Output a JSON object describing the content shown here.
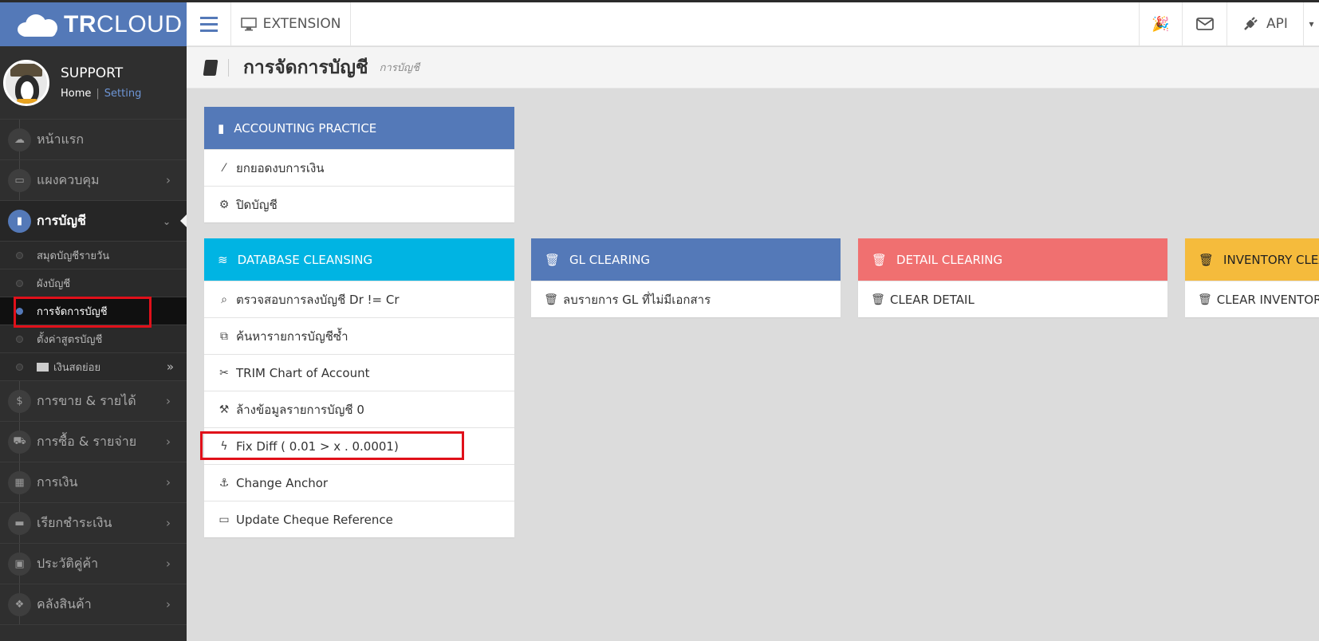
{
  "brand": {
    "name_bold": "TR",
    "name_light": "CLOUD",
    "color": "#5479b8"
  },
  "header": {
    "extension_label": "EXTENSION",
    "api_label": "API"
  },
  "profile": {
    "name": "SUPPORT",
    "home": "Home",
    "separator": "|",
    "setting": "Setting"
  },
  "sidebar": {
    "items": [
      {
        "label": "หน้าแรก",
        "icon": "cloud-icon"
      },
      {
        "label": "แผงควบคุม",
        "icon": "monitor-icon"
      },
      {
        "label": "การบัญชี",
        "icon": "book-icon"
      },
      {
        "label": "การขาย & รายได้",
        "icon": "dollar-icon"
      },
      {
        "label": "การซื้อ & รายจ่าย",
        "icon": "cart-icon"
      },
      {
        "label": "การเงิน",
        "icon": "calendar-icon"
      },
      {
        "label": "เรียกชำระเงิน",
        "icon": "credit-card-icon"
      },
      {
        "label": "ประวัติคู่ค้า",
        "icon": "contact-icon"
      },
      {
        "label": "คลังสินค้า",
        "icon": "cubes-icon"
      }
    ],
    "subitems": [
      {
        "label": "สมุดบัญชีรายวัน"
      },
      {
        "label": "ผังบัญชี"
      },
      {
        "label": "การจัดการบัญชี"
      },
      {
        "label": "ตั้งค่าสูตรบัญชี"
      },
      {
        "label": "เงินสดย่อย"
      }
    ]
  },
  "page": {
    "title": "การจัดการบัญชี",
    "subtitle": "การบัญชี"
  },
  "panels": {
    "accounting": {
      "title": "ACCOUNTING PRACTICE",
      "color": "#5479b8",
      "rows": [
        {
          "label": "ยกยอดงบการเงิน",
          "icon": "magic-wand-icon"
        },
        {
          "label": "ปิดบัญชี",
          "icon": "gear-icon"
        }
      ]
    },
    "cleansing": {
      "title": "DATABASE CLEANSING",
      "color": "#00b4e3",
      "rows": [
        {
          "label": "ตรวจสอบการลงบัญชี Dr != Cr",
          "icon": "search-icon"
        },
        {
          "label": "ค้นหารายการบัญชีซ้ำ",
          "icon": "copy-icon"
        },
        {
          "label": "TRIM Chart of Account",
          "icon": "scissors-icon"
        },
        {
          "label": "ล้างข้อมูลรายการบัญชี 0",
          "icon": "wrench-icon"
        },
        {
          "label": "Fix Diff ( 0.01 > x . 0.0001)",
          "icon": "bolt-icon"
        },
        {
          "label": "Change Anchor",
          "icon": "anchor-icon"
        },
        {
          "label": "Update Cheque Reference",
          "icon": "credit-card-icon"
        }
      ]
    },
    "gl": {
      "title": "GL CLEARING",
      "color": "#5479b8",
      "rows": [
        {
          "label": "ลบรายการ GL ที่ไม่มีเอกสาร",
          "icon": "trash-icon"
        }
      ]
    },
    "detail": {
      "title": "DETAIL CLEARING",
      "color": "#f07070",
      "rows": [
        {
          "label": "CLEAR DETAIL",
          "icon": "trash-icon"
        }
      ]
    },
    "inventory": {
      "title": "INVENTORY CLEARING",
      "color": "#f5bb3c",
      "rows": [
        {
          "label": "CLEAR INVENTORY",
          "icon": "trash-icon"
        }
      ]
    }
  },
  "highlight_color": "#e0101a"
}
